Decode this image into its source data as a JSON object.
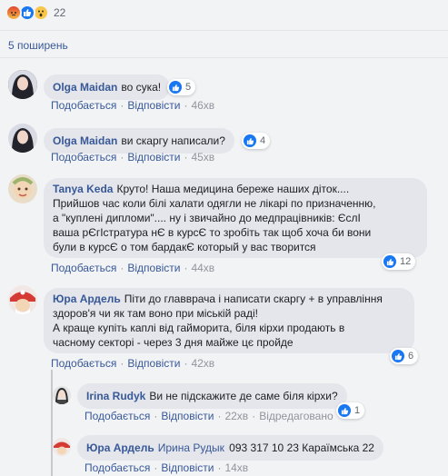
{
  "reactions": {
    "count": "22",
    "types": [
      "angry",
      "like",
      "wow"
    ]
  },
  "shares": "5 поширень",
  "comments": [
    {
      "author": "Olga Maidan",
      "text": "во сука!",
      "likes": "5",
      "like_label": "Подобається",
      "reply_label": "Відповісти",
      "time": "46хв"
    },
    {
      "author": "Olga Maidan",
      "text": "ви скаргу написали?",
      "likes": "4",
      "like_label": "Подобається",
      "reply_label": "Відповісти",
      "time": "45хв"
    },
    {
      "author": "Tanya Keda",
      "text_lines": [
        "Круто! Наша медицина береже наших діток....",
        "Прийшов час коли білі халати одягли не лікарі по призначенню,",
        "а \"куплені дипломи\".... ну і звичайно до медпрацівників: ЄслІ",
        "ваша рЄгІстратура нЄ в курсЄ то зробіть так щоб хоча би вони",
        "були в курсЄ о том бардакЄ который у вас творится"
      ],
      "likes": "12",
      "like_label": "Подобається",
      "reply_label": "Відповісти",
      "time": "44хв"
    },
    {
      "author": "Юра Ардель",
      "text_lines": [
        "Піти до главврача і написати скаргу + в управління",
        "здоров'я чи як там воно при міській раді!",
        "А краще купіть каплі від гайморита, біля кірхи продають в",
        "часному секторі - через 3 дня майже цє пройде"
      ],
      "likes": "6",
      "like_label": "Подобається",
      "reply_label": "Відповісти",
      "time": "42хв"
    }
  ],
  "replies": [
    {
      "author": "Irina Rudyk",
      "text": "Ви не підскажите де саме біля кірхи?",
      "likes": "1",
      "like_label": "Подобається",
      "reply_label": "Відповісти",
      "time": "22хв",
      "edited": "Відредаговано"
    },
    {
      "author": "Юра Ардель",
      "mention": "Ирина Рудык",
      "text": "093 317 10 23 Караїмська 22",
      "like_label": "Подобається",
      "reply_label": "Відповісти",
      "time": "14хв"
    }
  ],
  "colors": {
    "link": "#385898",
    "bubble": "#e4e6eb",
    "like_blue": "#1877f2"
  }
}
